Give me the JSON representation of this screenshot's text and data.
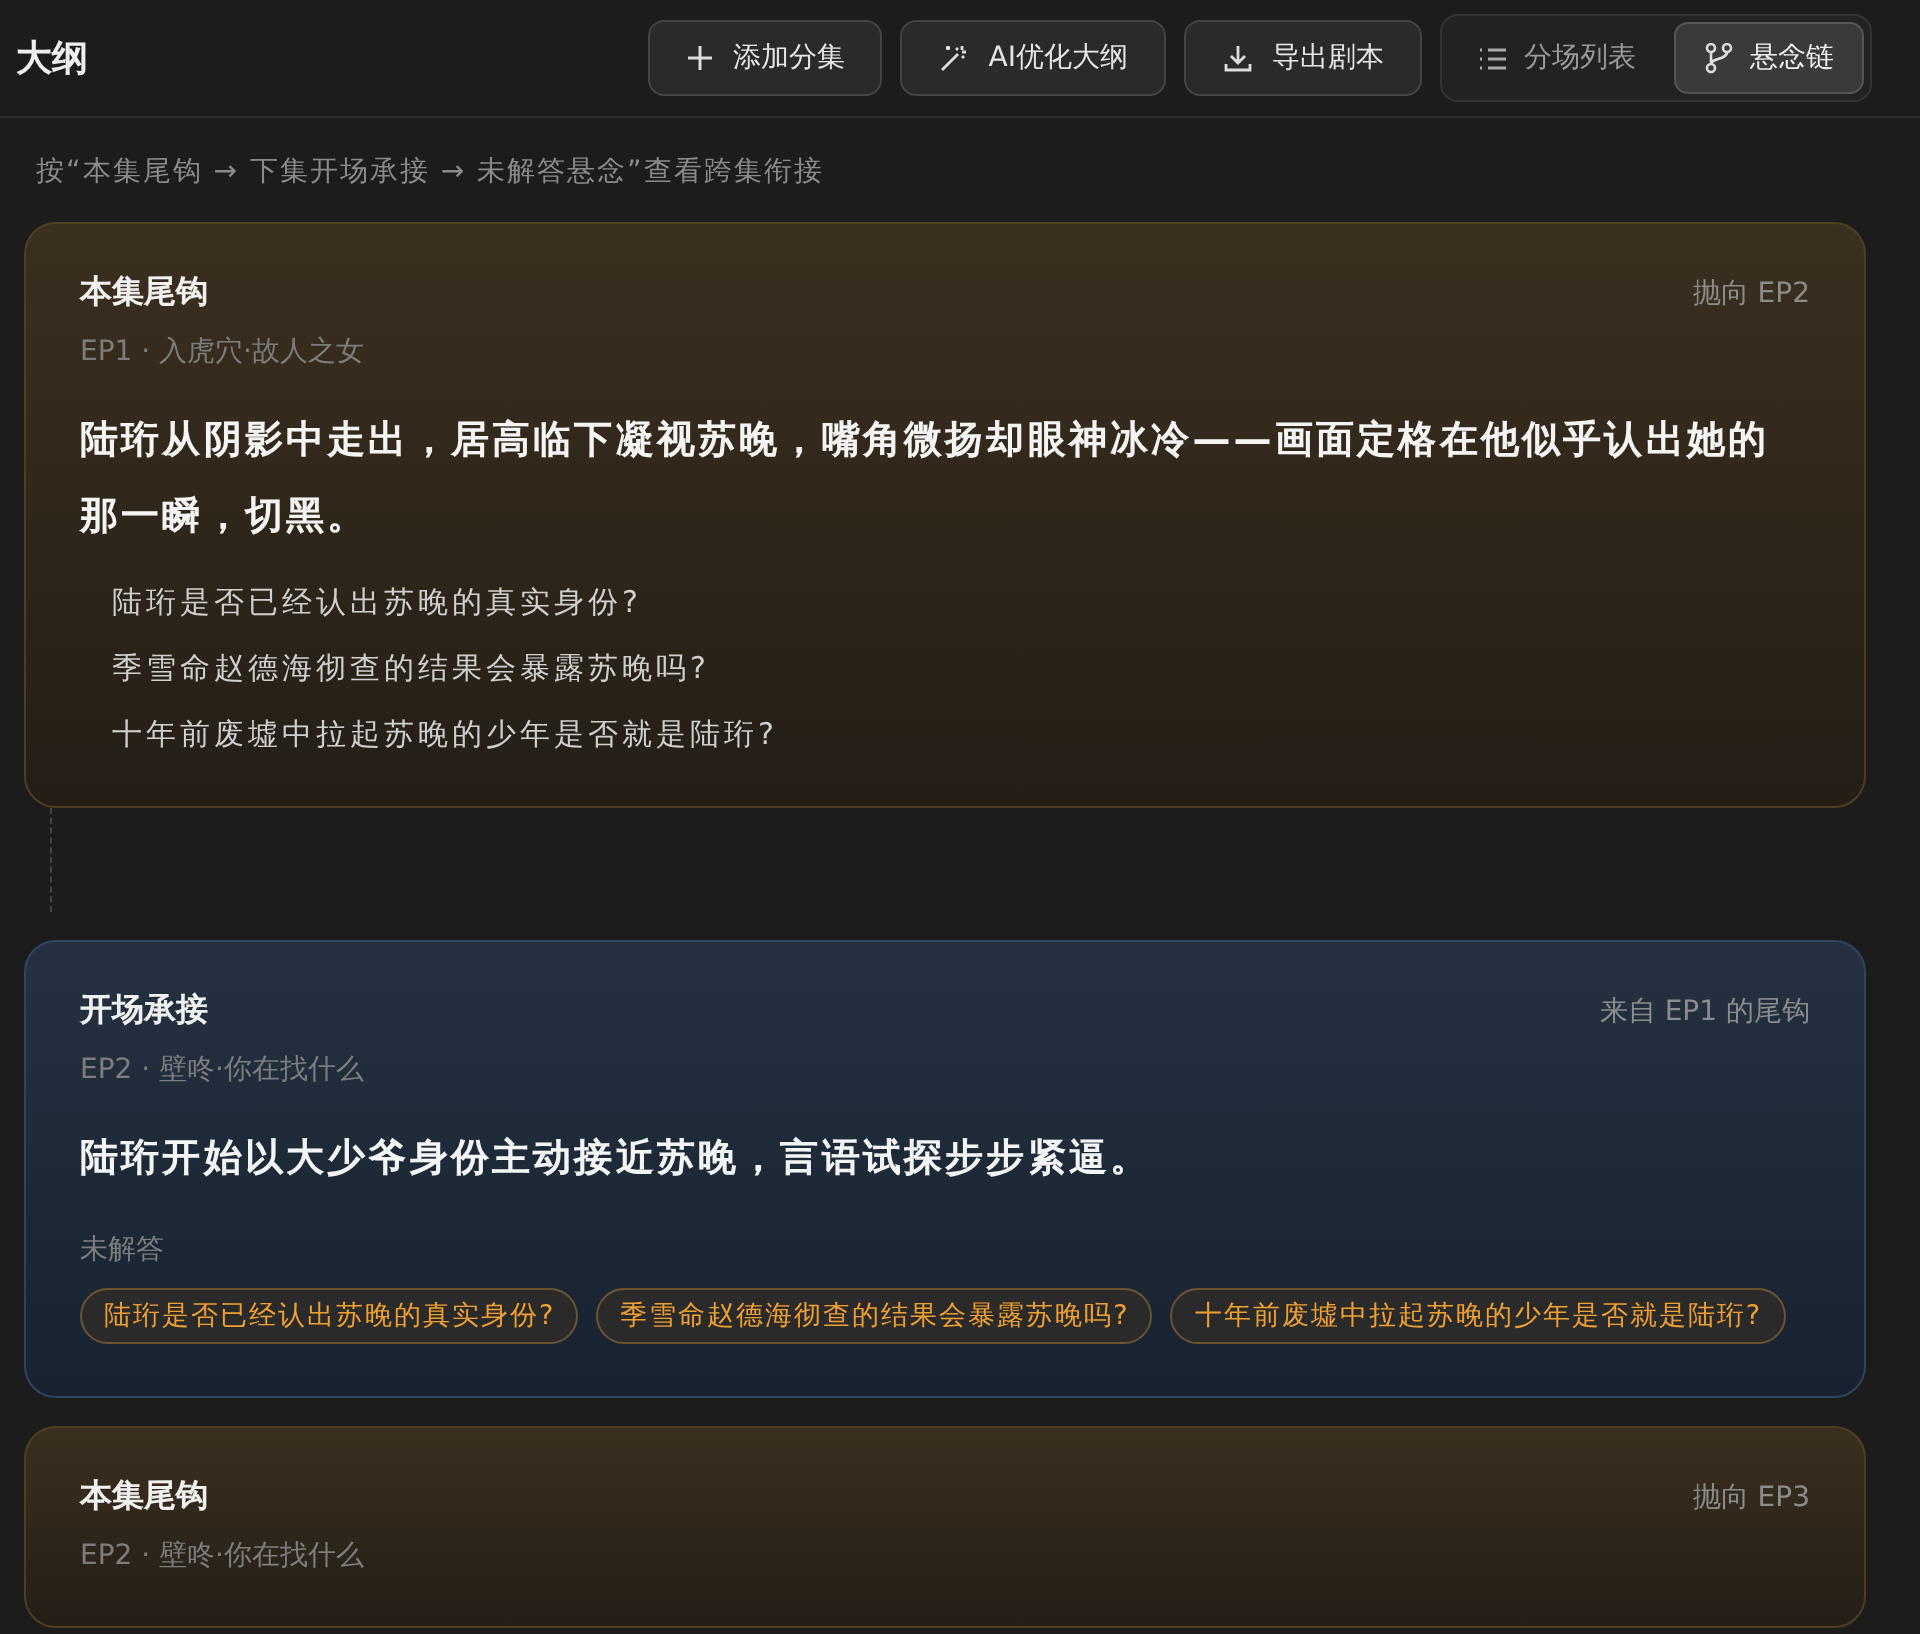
{
  "header": {
    "title": "大纲",
    "actions": [
      {
        "label": "添加分集",
        "kind": "add"
      },
      {
        "label": "AI优化大纲",
        "kind": "optimize"
      },
      {
        "label": "导出剧本",
        "kind": "export"
      }
    ],
    "views": [
      {
        "label": "分场列表",
        "kind": "list",
        "selected": false
      },
      {
        "label": "悬念链",
        "kind": "chain",
        "selected": true
      }
    ]
  },
  "hint": "按“本集尾钩 → 下集开场承接 → 未解答悬念”查看跨集衔接",
  "cards": [
    {
      "kind": "hook",
      "title": "本集尾钩",
      "link": "抛向 EP2",
      "episode": "EP1 · 入虎穴·故人之女",
      "body": "陆珩从阴影中走出，居高临下凝视苏晚，嘴角微扬却眼神冰冷——画面定格在他似乎认出她的那一瞬，切黑。",
      "questions": [
        "陆珩是否已经认出苏晚的真实身份?",
        "季雪命赵德海彻查的结果会暴露苏晚吗?",
        "十年前废墟中拉起苏晚的少年是否就是陆珩?"
      ]
    },
    {
      "kind": "opening",
      "title": "开场承接",
      "link": "来自 EP1 的尾钩",
      "episode": "EP2 · 壁咚·你在找什么",
      "body": "陆珩开始以大少爷身份主动接近苏晚，言语试探步步紧逼。",
      "unanswered_label": "未解答",
      "questions": [
        "陆珩是否已经认出苏晚的真实身份?",
        "季雪命赵德海彻查的结果会暴露苏晚吗?",
        "十年前废墟中拉起苏晚的少年是否就是陆珩?"
      ]
    },
    {
      "kind": "hook",
      "title": "本集尾钩",
      "link": "抛向 EP3",
      "episode": "EP2 · 壁咚·你在找什么"
    }
  ]
}
